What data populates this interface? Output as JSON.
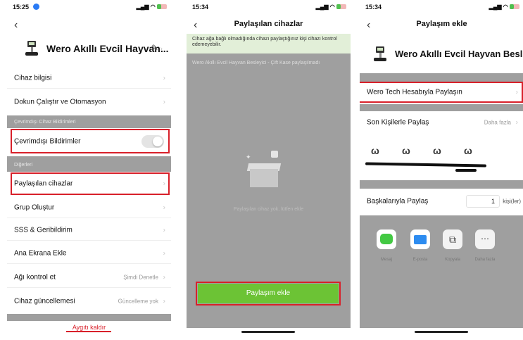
{
  "phone1": {
    "status": {
      "time": "15:25",
      "icons": "▐▐▐ ◠"
    },
    "back": "‹",
    "device_name": "Wero Akıllı Evcil Hayvan...",
    "edit": "✎",
    "items": {
      "device_info": "Cihaz bilgisi",
      "tap_run": "Dokun Çalıştır ve Otomasyon",
      "section_offline": "Çevrimdışı Cihaz Bildirimleri",
      "offline_notif": "Çevrimdışı Bildirimler",
      "section_other": "Diğerleri",
      "shared_devices": "Paylaşılan cihazlar",
      "create_group": "Grup Oluştur",
      "faq": "SSS & Geribildirim",
      "add_home": "Ana Ekrana Ekle",
      "network_check": "Ağı kontrol et",
      "network_check_val": "Şimdi Denetle",
      "fw_update": "Cihaz güncellemesi",
      "fw_update_val": "Güncelleme yok",
      "remove": "Aygıtı kaldır"
    },
    "chevron": "›"
  },
  "phone2": {
    "status": {
      "time": "15:34"
    },
    "title": "Paylaşılan cihazlar",
    "info": "Cihaz ağa bağlı olmadığında cihazı paylaştığınız kişi cihazı kontrol edemeyebilir.",
    "shared_item": "Wero Akıllı Evcil Hayvan Besleyici - Çift Kase paylaşılmadı",
    "empty_text": "Paylaşılan cihaz yok, lütfen ekle",
    "add_share": "Paylaşım ekle"
  },
  "phone3": {
    "status": {
      "time": "15:34"
    },
    "title": "Paylaşım ekle",
    "device_name": "Wero Akıllı Evcil Hayvan Besl...",
    "share_account": "Wero Tech Hesabıyla Paylaşın",
    "recent": "Son Kişilerle Paylaş",
    "more": "Daha fazla",
    "contact_initial": "ω",
    "share_others": "Başkalarıyla Paylaş",
    "qty": "1",
    "qty_unit": "kişi(ler)",
    "apps": {
      "message": "Mesaj",
      "email": "E-posta",
      "copy": "Kopyala",
      "more": "Daha fazla"
    }
  },
  "colors": {
    "accent_green": "#6cc335",
    "highlight_red": "#d8202a",
    "overlay_gray": "#9f9f9f"
  }
}
